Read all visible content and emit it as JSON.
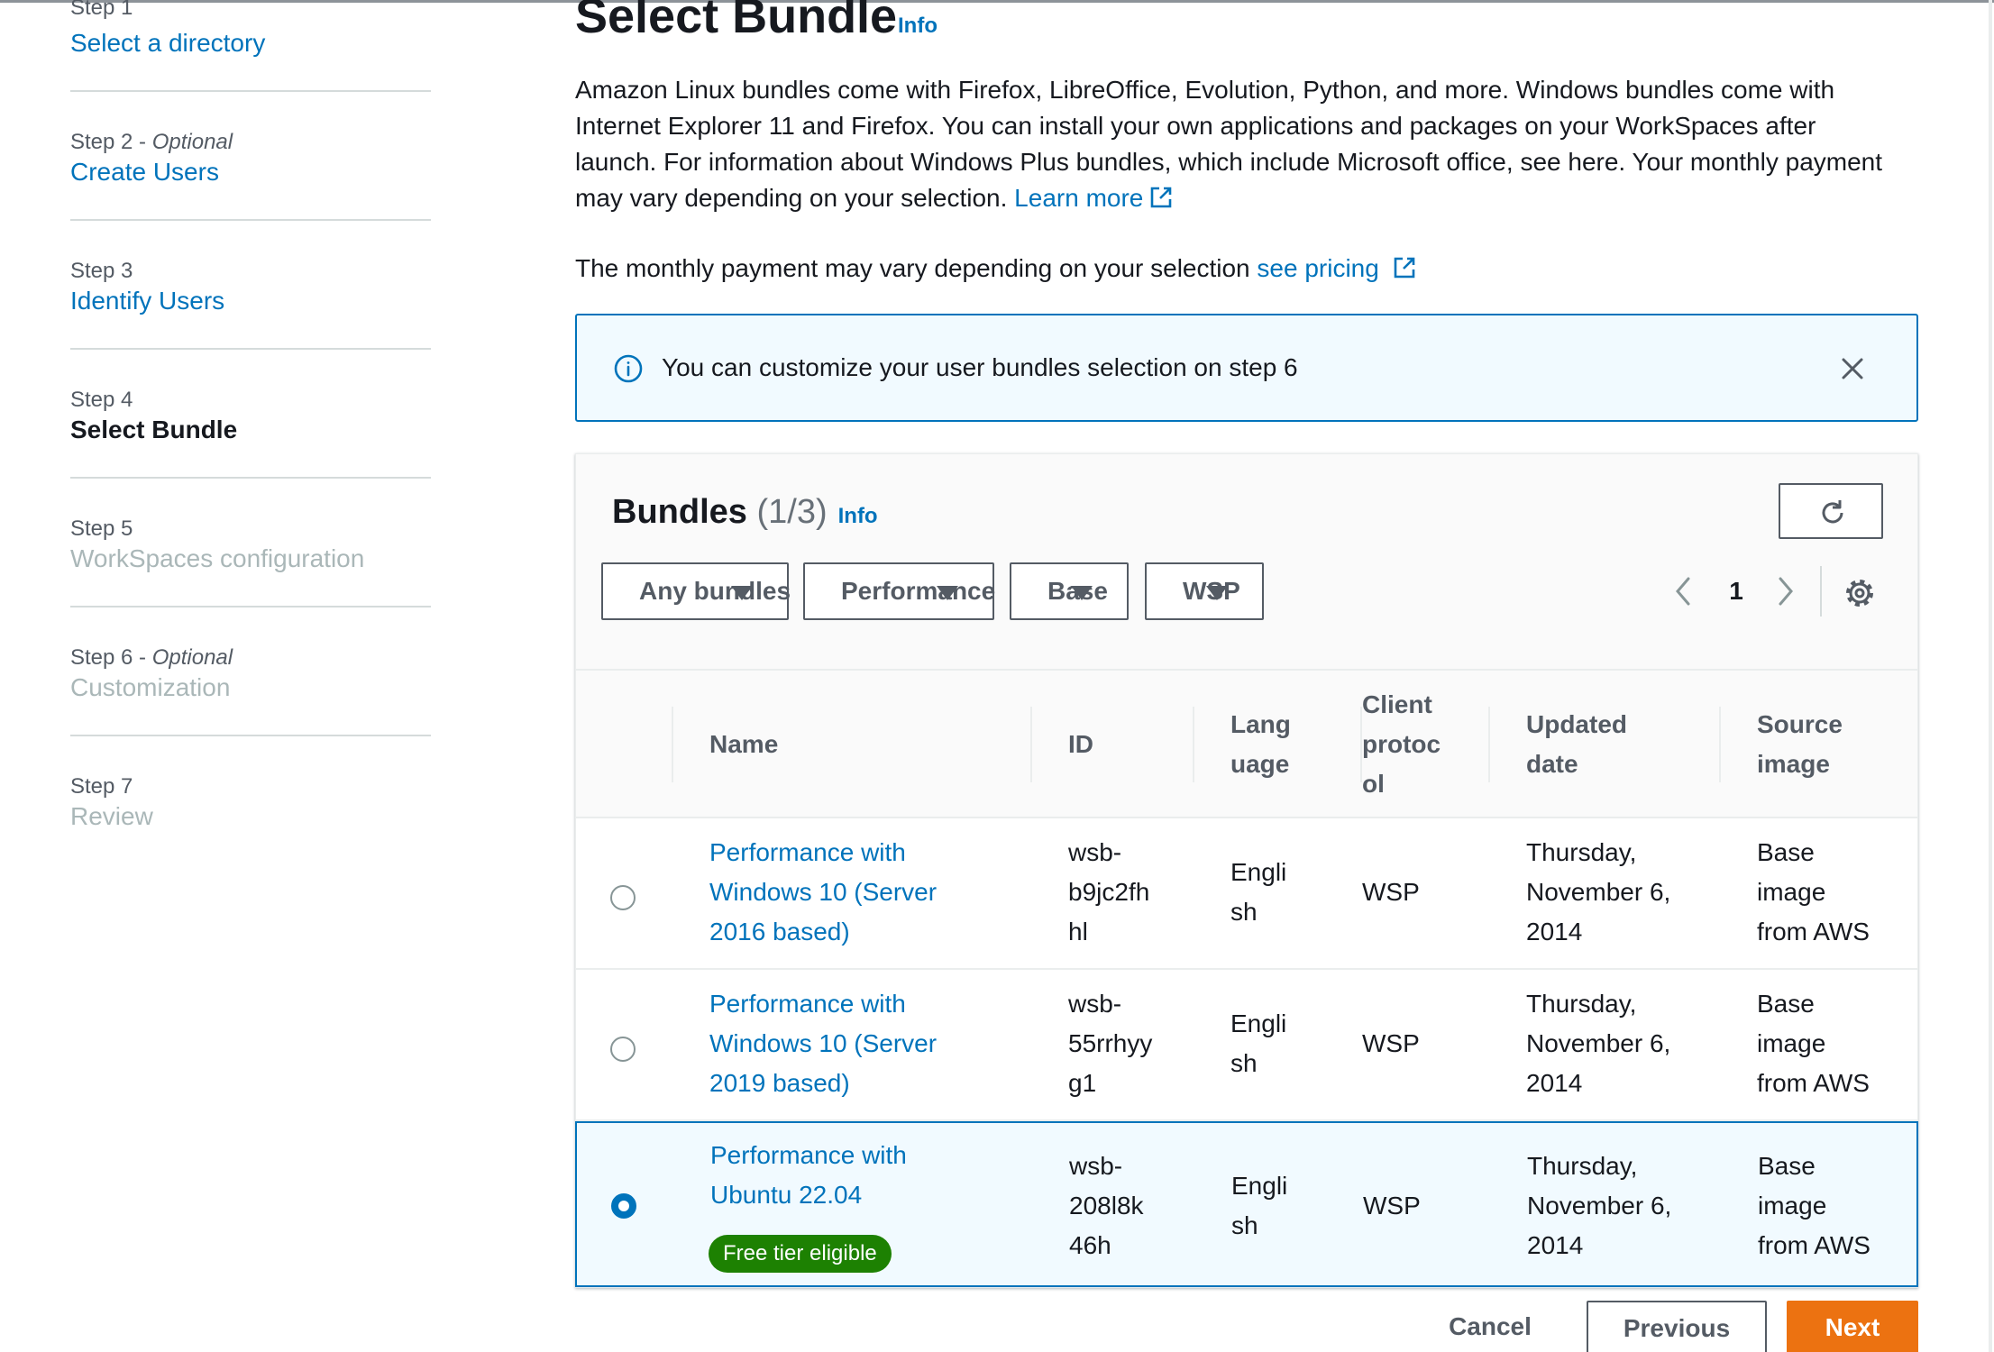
{
  "wizard": {
    "steps": [
      {
        "number": "Step 1",
        "optional": "",
        "label": "Select a directory",
        "state": "link"
      },
      {
        "number": "Step 2 - ",
        "optional": "Optional",
        "label": "Create Users",
        "state": "link"
      },
      {
        "number": "Step 3",
        "optional": "",
        "label": "Identify Users",
        "state": "link"
      },
      {
        "number": "Step 4",
        "optional": "",
        "label": "Select Bundle",
        "state": "current"
      },
      {
        "number": "Step 5",
        "optional": "",
        "label": "WorkSpaces configuration",
        "state": "disabled"
      },
      {
        "number": "Step 6 - ",
        "optional": "Optional",
        "label": "Customization",
        "state": "disabled"
      },
      {
        "number": "Step 7",
        "optional": "",
        "label": "Review",
        "state": "disabled"
      }
    ]
  },
  "page": {
    "title": "Select Bundle",
    "info": "Info",
    "description": "Amazon Linux bundles come with Firefox, LibreOffice, Evolution, Python, and more. Windows bundles come with Internet Explorer 11 and Firefox. You can install your own applications and packages on your WorkSpaces after launch. For information about Windows Plus bundles, which include Microsoft office, see here. Your monthly payment may vary depending on your selection.",
    "learn_more": "Learn more",
    "pricing_text": "The monthly payment may vary depending on your selection",
    "pricing_link": "see pricing"
  },
  "alert": {
    "text": "You can customize your user bundles selection on step 6"
  },
  "bundles": {
    "title": "Bundles",
    "count": "(1/3)",
    "info": "Info",
    "filters": [
      "Any bundles",
      "Performance",
      "Base",
      "WSP"
    ],
    "page": "1",
    "columns": [
      "Name",
      "ID",
      "Lang\nuage",
      "Client\nprotoc\nol",
      "Updated\ndate",
      "Source\nimage"
    ],
    "rows": [
      {
        "name": "Performance with\nWindows 10 (Server\n2016 based)",
        "id": "wsb-\nb9jc2fh\nhl",
        "language": "Engli\nsh",
        "protocol": "WSP",
        "updated": "Thursday,\nNovember 6,\n2014",
        "source": "Base\nimage\nfrom AWS",
        "selected": false,
        "badge": ""
      },
      {
        "name": "Performance with\nWindows 10 (Server\n2019 based)",
        "id": "wsb-\n55rrhyy\ng1",
        "language": "Engli\nsh",
        "protocol": "WSP",
        "updated": "Thursday,\nNovember 6,\n2014",
        "source": "Base\nimage\nfrom AWS",
        "selected": false,
        "badge": ""
      },
      {
        "name": "Performance with\nUbuntu 22.04",
        "id": "wsb-\n208l8k\n46h",
        "language": "Engli\nsh",
        "protocol": "WSP",
        "updated": "Thursday,\nNovember 6,\n2014",
        "source": "Base\nimage\nfrom AWS",
        "selected": true,
        "badge": "Free tier eligible"
      }
    ]
  },
  "actions": {
    "cancel": "Cancel",
    "previous": "Previous",
    "next": "Next"
  },
  "icons": {
    "external": "external-link-icon",
    "info": "info-circle-icon",
    "close": "close-icon",
    "refresh": "refresh-icon",
    "caret": "caret-down-icon",
    "prev": "chevron-left-icon",
    "next": "chevron-right-icon",
    "settings": "gear-icon"
  },
  "colors": {
    "link": "#0073bb",
    "primary_button": "#ec7211",
    "badge": "#1d8102",
    "alert_bg": "#f1faff"
  }
}
